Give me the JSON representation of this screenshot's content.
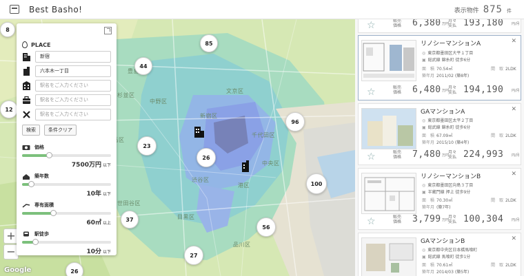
{
  "header": {
    "title": "Best Basho!",
    "count_label": "表示物件",
    "count_value": "875",
    "count_unit": "件"
  },
  "panel": {
    "place_label": "PLACE",
    "stations": [
      {
        "value": "新宿",
        "placeholder": ""
      },
      {
        "value": "六本木一丁目",
        "placeholder": ""
      },
      {
        "value": "",
        "placeholder": "駅名をご入力ください"
      },
      {
        "value": "",
        "placeholder": "駅名をご入力ください"
      },
      {
        "value": "",
        "placeholder": "駅名をご入力ください"
      }
    ],
    "search_button": "検索",
    "clear_button": "条件クリア",
    "filters": [
      {
        "label": "価格",
        "value": "7500万円",
        "suffix": "以下",
        "level": 0.3
      },
      {
        "label": "築年数",
        "value": "10年",
        "suffix": "以下",
        "level": 0.1
      },
      {
        "label": "専有面積",
        "value": "60㎡",
        "suffix": "以上",
        "level": 0.35
      },
      {
        "label": "駅徒歩",
        "value": "10分",
        "suffix": "以下",
        "level": 0.15
      }
    ]
  },
  "map": {
    "wards": [
      "豊島区",
      "文京区",
      "中野区",
      "新宿区",
      "千代田区",
      "中央区",
      "渋谷区",
      "港区",
      "世田谷区",
      "目黒区",
      "品川区",
      "練馬区",
      "杉並区"
    ],
    "clusters": [
      "8",
      "85",
      "44",
      "12",
      "96",
      "23",
      "26",
      "100",
      "37",
      "56",
      "27",
      "26"
    ],
    "zoom_in": "+",
    "zoom_out": "−",
    "attribution": "Google"
  },
  "listings": [
    {
      "name": "",
      "address": "",
      "station": "",
      "price_label": "販売\n価格",
      "price": "6,380",
      "price_unit": "万円",
      "monthly_label": "月々\n支払",
      "monthly": "193,180",
      "monthly_unit": "円/月"
    },
    {
      "name": "リノシーマンションA",
      "address": "東京都墨田区大平１丁目",
      "station": "総武線 錦糸町 徒歩6分",
      "area_label": "面　積",
      "area": "70.54㎡",
      "layout_label": "間　取",
      "layout": "2LDK",
      "built_label": "築年月",
      "built": "2011/02 (築8年)",
      "price_label": "販売\n価格",
      "price": "6,480",
      "price_unit": "万円",
      "monthly_label": "月々\n支払",
      "monthly": "194,190",
      "monthly_unit": "円/月"
    },
    {
      "name": "GAマンションA",
      "address": "東京都墨田区太平２丁目",
      "station": "総武線 錦糸町 徒歩6分",
      "area_label": "面　積",
      "area": "67.09㎡",
      "layout_label": "間　取",
      "layout": "2LDK",
      "built_label": "築年月",
      "built": "2015/10 (築4年)",
      "price_label": "販売\n価格",
      "price": "7,480",
      "price_unit": "万円",
      "monthly_label": "月々\n支払",
      "monthly": "224,993",
      "monthly_unit": "円/月"
    },
    {
      "name": "リノシーマンションB",
      "address": "東京都墨田区向島３丁目",
      "station": "半蔵門線 押上 徒歩9分",
      "area_label": "面　積",
      "area": "70.30㎡",
      "layout_label": "間　取",
      "layout": "2LDK",
      "built_label": "築年月",
      "built": "(築7年)",
      "price_label": "販売\n価格",
      "price": "3,799",
      "price_unit": "万円",
      "monthly_label": "月々\n支払",
      "monthly": "100,304",
      "monthly_unit": "円/月"
    },
    {
      "name": "GAマンションB",
      "address": "東京都中央区日本橋馬喰町",
      "station": "総武線 馬喰町 徒歩1分",
      "area_label": "面　積",
      "area": "70.61㎡",
      "layout_label": "間　取",
      "layout": "2LDK",
      "built_label": "築年月",
      "built": "2014/03 (築5年)"
    }
  ]
}
